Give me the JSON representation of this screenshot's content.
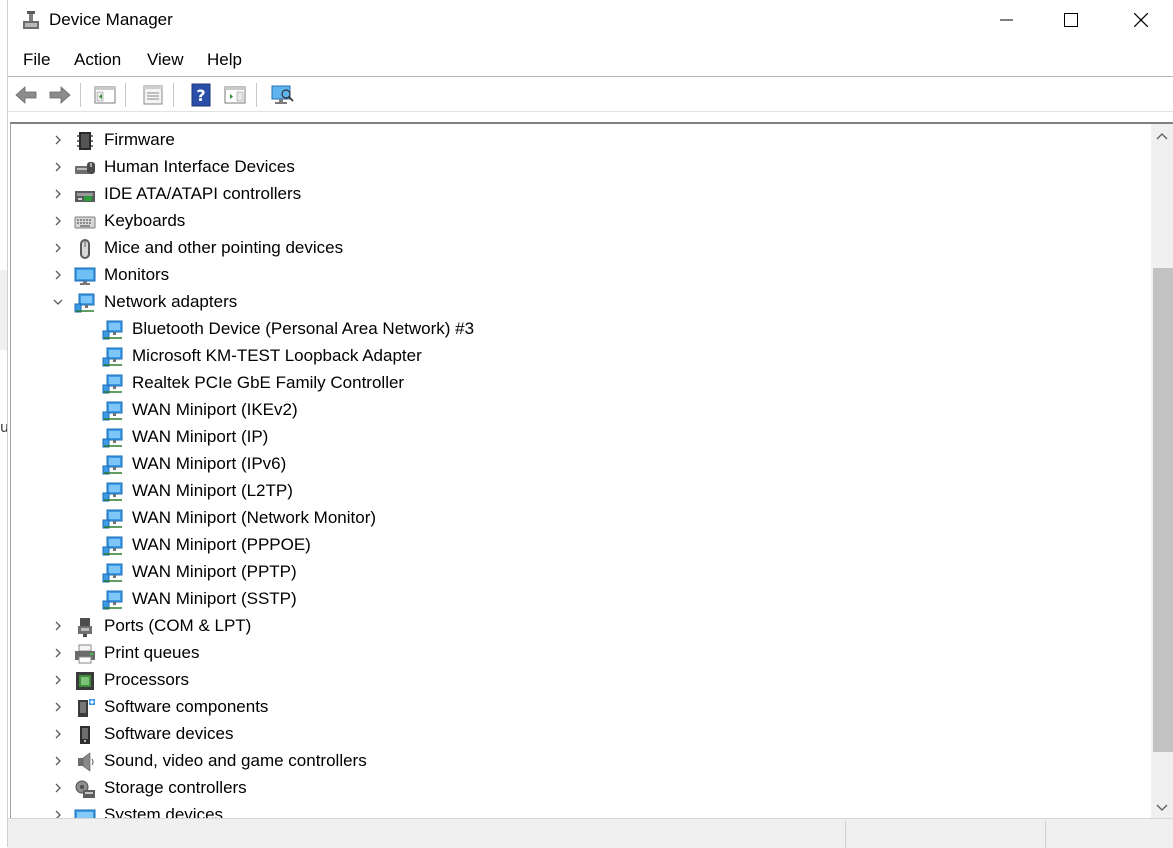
{
  "window": {
    "title": "Device Manager"
  },
  "title_buttons": [
    {
      "name": "minimize",
      "icon": "minimize-icon"
    },
    {
      "name": "maximize",
      "icon": "maximize-icon"
    },
    {
      "name": "close",
      "icon": "close-icon"
    }
  ],
  "menu": [
    "File",
    "Action",
    "View",
    "Help"
  ],
  "toolbar": [
    {
      "name": "back",
      "icon": "back-arrow-icon"
    },
    {
      "name": "forward",
      "icon": "forward-arrow-icon"
    },
    {
      "name": "show-hide-console-tree",
      "icon": "console-tree-icon"
    },
    {
      "name": "properties",
      "icon": "properties-icon"
    },
    {
      "name": "help",
      "icon": "help-icon"
    },
    {
      "name": "show-hide-action-pane",
      "icon": "action-pane-icon"
    },
    {
      "name": "scan-hardware",
      "icon": "scan-hardware-icon"
    }
  ],
  "tree": [
    {
      "label": "Firmware",
      "icon": "firmware-icon",
      "state": "collapsed",
      "level": 0
    },
    {
      "label": "Human Interface Devices",
      "icon": "hid-icon",
      "state": "collapsed",
      "level": 0
    },
    {
      "label": "IDE ATA/ATAPI controllers",
      "icon": "ide-controller-icon",
      "state": "collapsed",
      "level": 0
    },
    {
      "label": "Keyboards",
      "icon": "keyboard-icon",
      "state": "collapsed",
      "level": 0
    },
    {
      "label": "Mice and other pointing devices",
      "icon": "mouse-icon",
      "state": "collapsed",
      "level": 0
    },
    {
      "label": "Monitors",
      "icon": "monitor-icon",
      "state": "collapsed",
      "level": 0
    },
    {
      "label": "Network adapters",
      "icon": "network-adapter-icon",
      "state": "expanded",
      "level": 0
    },
    {
      "label": "Bluetooth Device (Personal Area Network) #3",
      "icon": "network-adapter-icon",
      "state": "leaf",
      "level": 1
    },
    {
      "label": "Microsoft KM-TEST Loopback Adapter",
      "icon": "network-adapter-icon",
      "state": "leaf",
      "level": 1
    },
    {
      "label": "Realtek PCIe GbE Family Controller",
      "icon": "network-adapter-icon",
      "state": "leaf",
      "level": 1
    },
    {
      "label": "WAN Miniport (IKEv2)",
      "icon": "network-adapter-icon",
      "state": "leaf",
      "level": 1
    },
    {
      "label": "WAN Miniport (IP)",
      "icon": "network-adapter-icon",
      "state": "leaf",
      "level": 1
    },
    {
      "label": "WAN Miniport (IPv6)",
      "icon": "network-adapter-icon",
      "state": "leaf",
      "level": 1
    },
    {
      "label": "WAN Miniport (L2TP)",
      "icon": "network-adapter-icon",
      "state": "leaf",
      "level": 1
    },
    {
      "label": "WAN Miniport (Network Monitor)",
      "icon": "network-adapter-icon",
      "state": "leaf",
      "level": 1
    },
    {
      "label": "WAN Miniport (PPPOE)",
      "icon": "network-adapter-icon",
      "state": "leaf",
      "level": 1
    },
    {
      "label": "WAN Miniport (PPTP)",
      "icon": "network-adapter-icon",
      "state": "leaf",
      "level": 1
    },
    {
      "label": "WAN Miniport (SSTP)",
      "icon": "network-adapter-icon",
      "state": "leaf",
      "level": 1
    },
    {
      "label": "Ports (COM & LPT)",
      "icon": "port-icon",
      "state": "collapsed",
      "level": 0
    },
    {
      "label": "Print queues",
      "icon": "printer-icon",
      "state": "collapsed",
      "level": 0
    },
    {
      "label": "Processors",
      "icon": "processor-icon",
      "state": "collapsed",
      "level": 0
    },
    {
      "label": "Software components",
      "icon": "software-component-icon",
      "state": "collapsed",
      "level": 0
    },
    {
      "label": "Software devices",
      "icon": "software-device-icon",
      "state": "collapsed",
      "level": 0
    },
    {
      "label": "Sound, video and game controllers",
      "icon": "speaker-icon",
      "state": "collapsed",
      "level": 0
    },
    {
      "label": "Storage controllers",
      "icon": "storage-controller-icon",
      "state": "collapsed",
      "level": 0
    },
    {
      "label": "System devices",
      "icon": "system-devices-icon",
      "state": "collapsed",
      "level": 0
    }
  ],
  "colors": {
    "network_blue": "#3c9be8",
    "chevron": "#5a5a5a",
    "scroll_thumb": "#c2c2c2",
    "status_bar": "#f0f0f0"
  }
}
